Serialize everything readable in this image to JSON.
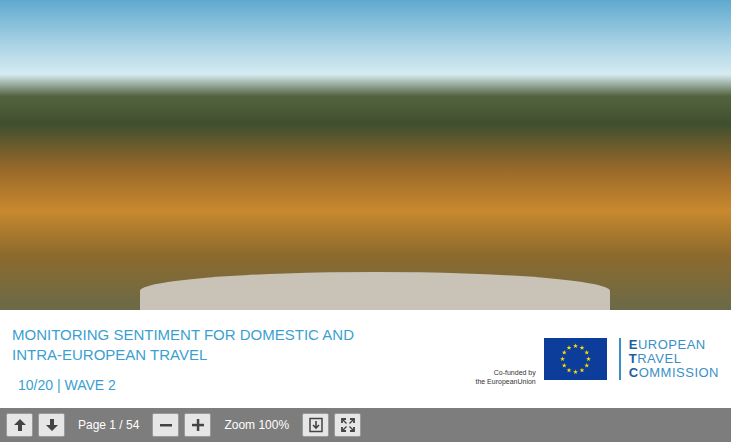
{
  "document": {
    "title_lines": [
      "MONITORING SENTIMENT FOR DOMESTIC AND",
      "INTRA-EUROPEAN TRAVEL"
    ],
    "edition": "10/20 | WAVE 2",
    "cofunded_lines": [
      "Co-funded by",
      "the EuropeanUnion"
    ],
    "logo_lines": [
      "EUROPEAN",
      "TRAVEL",
      "COMMISSION"
    ]
  },
  "toolbar": {
    "page_label": "Page 1 / 54",
    "zoom_label": "Zoom 100%"
  }
}
